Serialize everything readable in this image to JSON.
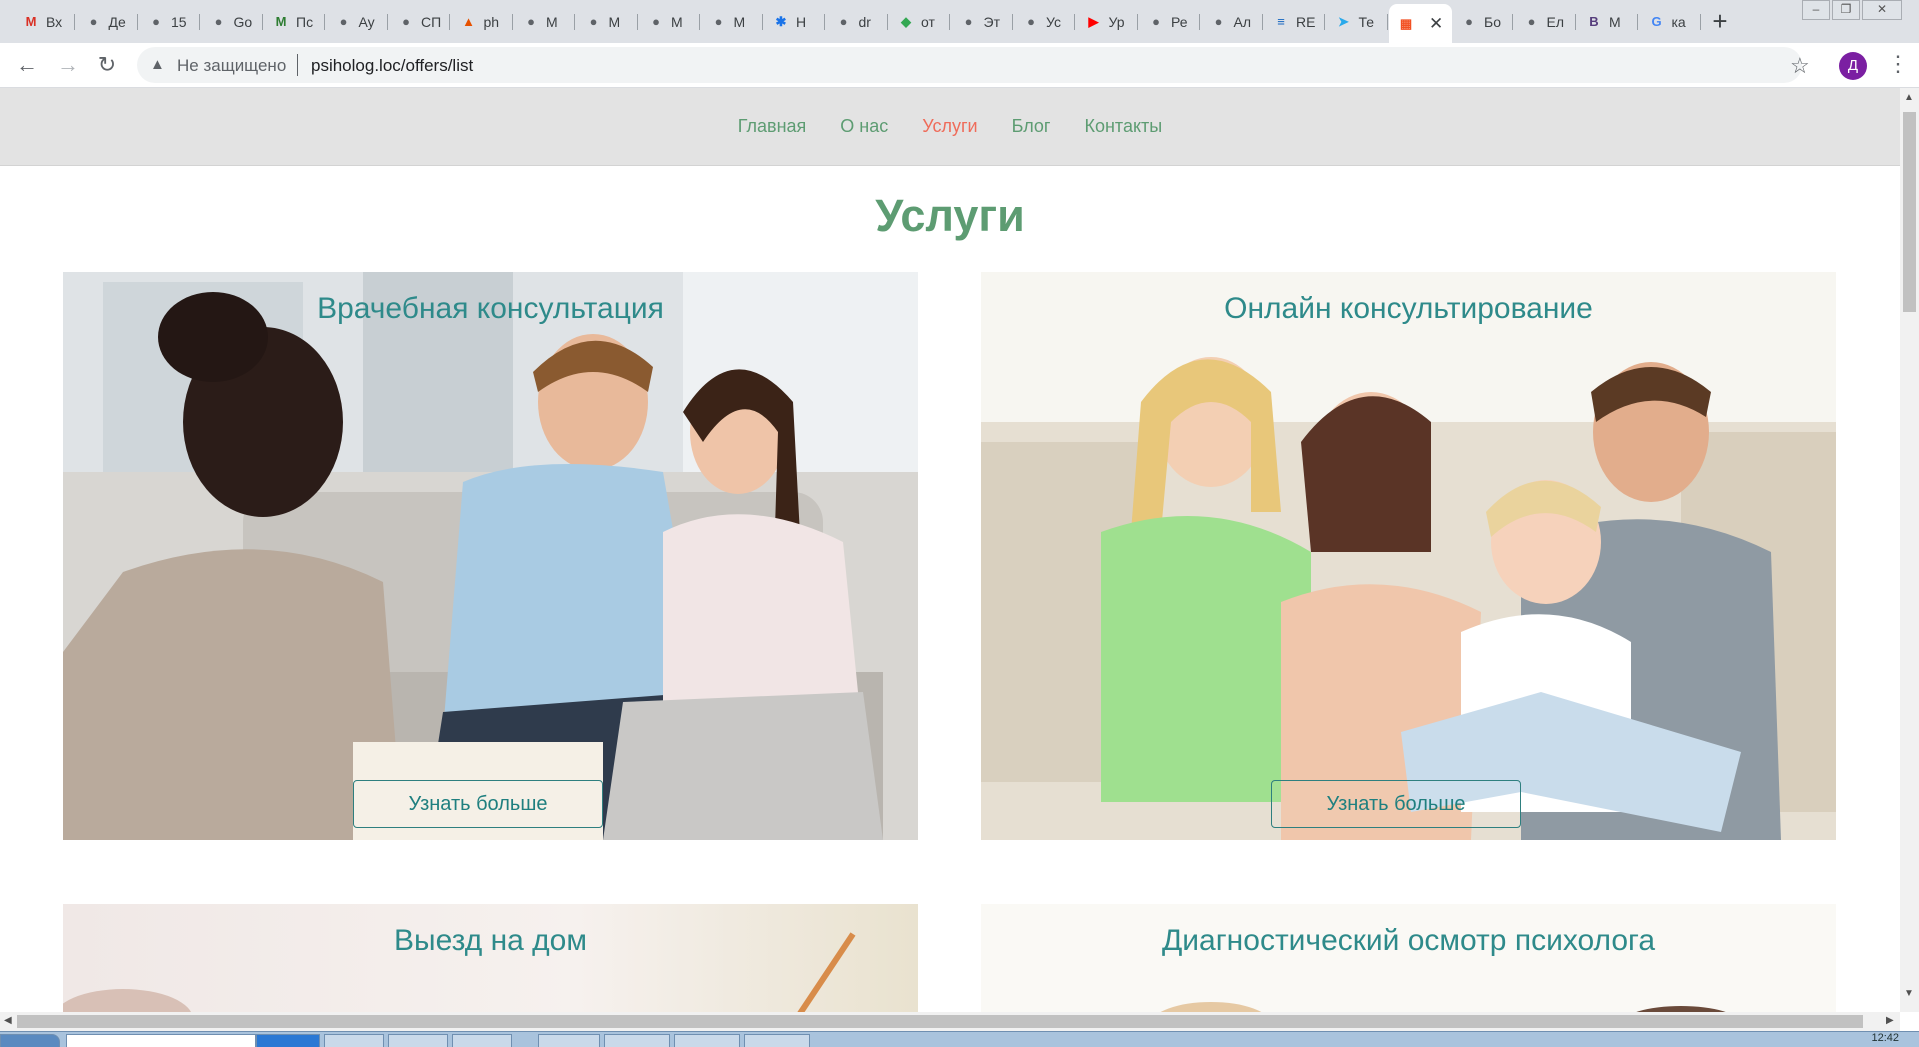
{
  "browser": {
    "tabs": [
      {
        "title": "Вх",
        "icon": "gmail-icon",
        "color": "#d93025",
        "glyph": "M"
      },
      {
        "title": "Де",
        "icon": "globe-icon",
        "color": "#5f6368",
        "glyph": "●"
      },
      {
        "title": "15",
        "icon": "globe-icon",
        "color": "#5f6368",
        "glyph": "●"
      },
      {
        "title": "Go",
        "icon": "globe-icon",
        "color": "#5f6368",
        "glyph": "●"
      },
      {
        "title": "Пс",
        "icon": "m-logo-icon",
        "color": "#2e7d32",
        "glyph": "M"
      },
      {
        "title": "Ау",
        "icon": "globe-icon",
        "color": "#5f6368",
        "glyph": "●"
      },
      {
        "title": "СП",
        "icon": "globe-icon",
        "color": "#5f6368",
        "glyph": "●"
      },
      {
        "title": "ph",
        "icon": "phpmyadmin-icon",
        "color": "#e65100",
        "glyph": "▲"
      },
      {
        "title": "М",
        "icon": "globe-icon",
        "color": "#5f6368",
        "glyph": "●"
      },
      {
        "title": "М",
        "icon": "globe-icon",
        "color": "#5f6368",
        "glyph": "●"
      },
      {
        "title": "М",
        "icon": "globe-icon",
        "color": "#5f6368",
        "glyph": "●"
      },
      {
        "title": "М",
        "icon": "globe-icon",
        "color": "#5f6368",
        "glyph": "●"
      },
      {
        "title": "Н",
        "icon": "gear-icon",
        "color": "#1a73e8",
        "glyph": "✱"
      },
      {
        "title": "dr",
        "icon": "globe-icon",
        "color": "#5f6368",
        "glyph": "●"
      },
      {
        "title": "от",
        "icon": "maps-pin-icon",
        "color": "#34a853",
        "glyph": "◆"
      },
      {
        "title": "Эт",
        "icon": "globe-icon",
        "color": "#5f6368",
        "glyph": "●"
      },
      {
        "title": "Ус",
        "icon": "globe-icon",
        "color": "#5f6368",
        "glyph": "●"
      },
      {
        "title": "Ур",
        "icon": "youtube-icon",
        "color": "#ff0000",
        "glyph": "▶"
      },
      {
        "title": "Ре",
        "icon": "globe-icon",
        "color": "#5f6368",
        "glyph": "●"
      },
      {
        "title": "Ал",
        "icon": "globe-icon",
        "color": "#5f6368",
        "glyph": "●"
      },
      {
        "title": "RE",
        "icon": "document-icon",
        "color": "#1565c0",
        "glyph": "≡"
      },
      {
        "title": "Те",
        "icon": "telegram-icon",
        "color": "#29a9eb",
        "glyph": "➤"
      },
      {
        "title": "",
        "icon": "windows-logo-icon",
        "color": "#f25022",
        "glyph": "▦",
        "active": true
      },
      {
        "title": "Бо",
        "icon": "globe-icon",
        "color": "#5f6368",
        "glyph": "●"
      },
      {
        "title": "Ел",
        "icon": "globe-icon",
        "color": "#5f6368",
        "glyph": "●"
      },
      {
        "title": "М",
        "icon": "bootstrap-icon",
        "color": "#563d7c",
        "glyph": "B"
      },
      {
        "title": "ка",
        "icon": "google-icon",
        "color": "#4285f4",
        "glyph": "G"
      }
    ],
    "security_label": "Не защищено",
    "url": "psiholog.loc/offers/list",
    "profile_initial": "Д"
  },
  "site": {
    "nav": [
      {
        "label": "Главная",
        "current": false
      },
      {
        "label": "О нас",
        "current": false
      },
      {
        "label": "Услуги",
        "current": true
      },
      {
        "label": "Блог",
        "current": false
      },
      {
        "label": "Контакты",
        "current": false
      }
    ],
    "heading": "Услуги",
    "services": [
      {
        "title": "Врачебная консультация",
        "button": "Узнать больше",
        "image": "psychologist-with-couple-photo"
      },
      {
        "title": "Онлайн консультирование",
        "button": "Узнать больше",
        "image": "family-reading-book-photo"
      },
      {
        "title": "Выезд на дом",
        "image": "writing-pen-photo"
      },
      {
        "title": "Диагностический осмотр психолога",
        "image": "family-photo"
      }
    ]
  },
  "taskbar": {
    "clock": "12:42"
  }
}
